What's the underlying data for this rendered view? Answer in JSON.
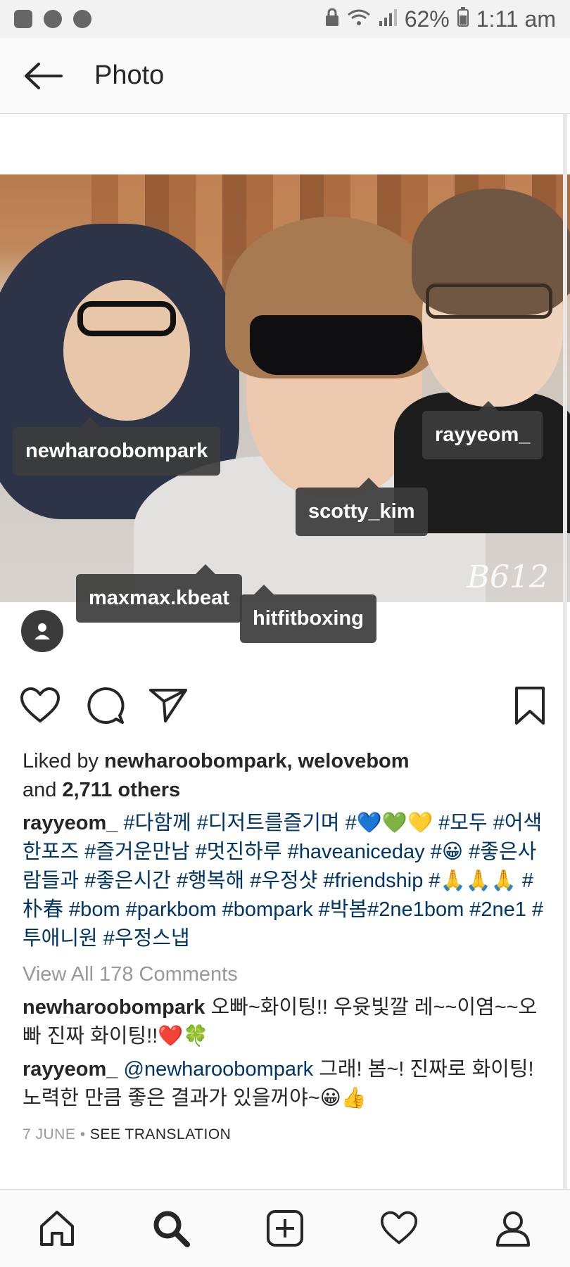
{
  "status_bar": {
    "battery": "62%",
    "time": "1:11 am",
    "icons": [
      "image-icon",
      "game-icon",
      "game-icon",
      "lock-icon",
      "wifi-icon",
      "signal-icon",
      "battery-icon"
    ]
  },
  "header": {
    "title": "Photo"
  },
  "photo": {
    "watermark": "B612",
    "tags": [
      "newharoobompark",
      "rayyeom_",
      "scotty_kim",
      "maxmax.kbeat",
      "hitfitboxing"
    ]
  },
  "post": {
    "likes_prefix": "Liked by ",
    "likes_users": "newharoobompark, welovebom",
    "likes_and": "and ",
    "likes_others": "2,711 others",
    "caption_user": "rayyeom_",
    "caption_text": "#다함께 #디저트를즐기며 #💙💚💛 #모두 #어색한포즈 #즐거운만남 #멋진하루 #haveaniceday #😀 #좋은사람들과 #좋은시간 #행복해 #우정샷 #friendship #🙏🙏🙏 #朴春 #bom #parkbom #bompark #박봄#2ne1bom #2ne1 #투애니원 #우정스냅",
    "view_all": "View All 178 Comments",
    "comments": [
      {
        "user": "newharoobompark",
        "mention": "",
        "text": "오빠~화이팅!! 우윳빛깔 레~~이염~~오빠  진짜 화이팅!!❤️🍀"
      },
      {
        "user": "rayyeom_",
        "mention": "@newharoobompark",
        "text": " 그래! 봄~! 진짜로 화이팅! 노력한 만큼 좋은 결과가 있을꺼야~😀👍"
      }
    ],
    "date": "7 JUNE",
    "separator": " • ",
    "translate": "SEE TRANSLATION"
  },
  "bottom_nav": [
    "home-icon",
    "search-icon",
    "add-icon",
    "heart-icon",
    "profile-icon"
  ]
}
